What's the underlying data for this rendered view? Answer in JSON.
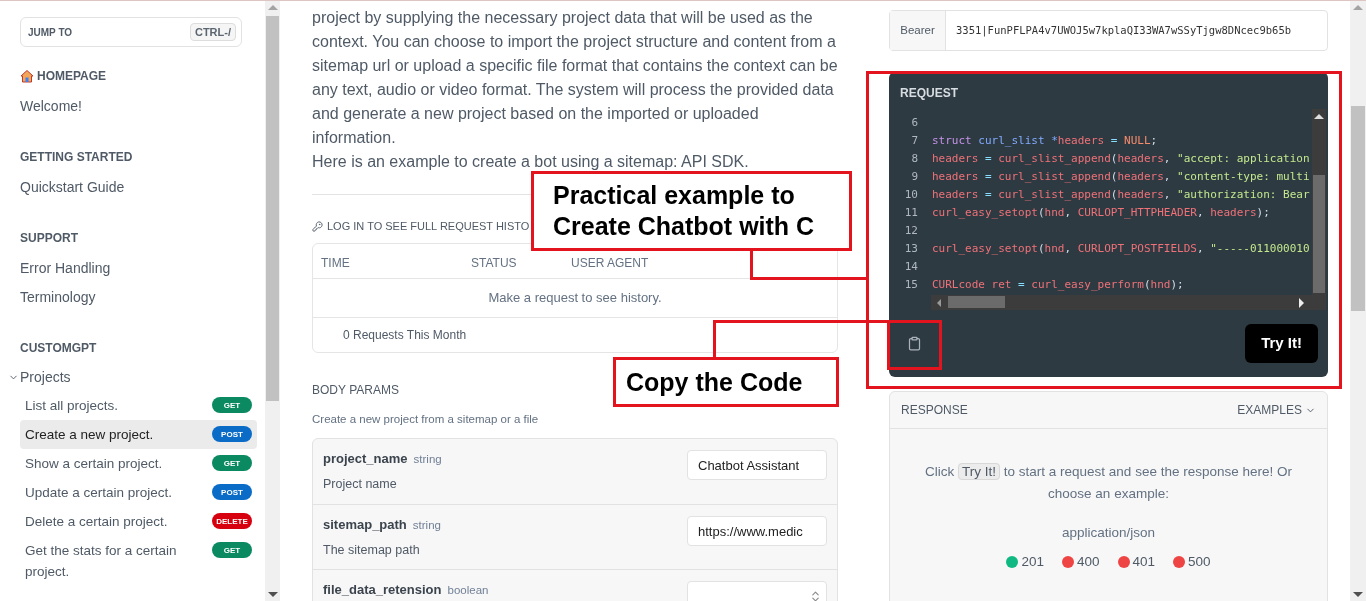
{
  "sidebar": {
    "jump_to": {
      "label": "JUMP TO",
      "shortcut": "CTRL-/"
    },
    "sections": [
      {
        "heading": "HOMEPAGE",
        "kind": "home",
        "items": [
          {
            "label": "Welcome!"
          }
        ]
      },
      {
        "heading": "GETTING STARTED",
        "items": [
          {
            "label": "Quickstart Guide"
          }
        ]
      },
      {
        "heading": "SUPPORT",
        "items": [
          {
            "label": "Error Handling"
          },
          {
            "label": "Terminology"
          }
        ]
      },
      {
        "heading": "CUSTOMGPT",
        "groups": [
          {
            "label": "Projects",
            "expanded": true,
            "children": [
              {
                "label": "List all projects.",
                "method": "GET",
                "color": "#0b8a62",
                "selected": false
              },
              {
                "label": "Create a new project.",
                "method": "POST",
                "color": "#0b6cc7",
                "selected": true
              },
              {
                "label": "Show a certain project.",
                "method": "GET",
                "color": "#0b8a62",
                "selected": false
              },
              {
                "label": "Update a certain project.",
                "method": "POST",
                "color": "#0b6cc7",
                "selected": false
              },
              {
                "label": "Delete a certain project.",
                "method": "DELETE",
                "color": "#d7000f",
                "selected": false
              },
              {
                "label": "Get the stats for a certain project.",
                "method": "GET",
                "color": "#0b8a62",
                "selected": false
              }
            ]
          }
        ]
      }
    ]
  },
  "intro": [
    "project by supplying the necessary project data that will be used as the context. You can choose to import the project structure and content from a sitemap url or upload a specific file format that contains the context can be any text, audio or video format. The system will process the provided data and generate a new project based on the imported or uploaded information.",
    "Here is an example to create a bot using a sitemap: API SDK."
  ],
  "history": {
    "heading": "LOG IN TO SEE FULL REQUEST HISTO",
    "columns": [
      "TIME",
      "STATUS",
      "USER AGENT"
    ],
    "empty": "Make a request to see history.",
    "footer": "0 Requests This Month"
  },
  "body_params": {
    "heading": "BODY PARAMS",
    "description": "Create a new project from a sitemap or a file",
    "params": [
      {
        "name": "project_name",
        "type": "string",
        "description": "Project name",
        "kind": "text",
        "value": "Chatbot Assistant"
      },
      {
        "name": "sitemap_path",
        "type": "string",
        "description": "The sitemap path",
        "kind": "text",
        "value": "https://www.medic"
      },
      {
        "name": "file_data_retension",
        "type": "boolean",
        "kind": "select"
      }
    ]
  },
  "auth": {
    "scheme": "Bearer",
    "token": "3351|FunPFLPA4v7UWOJ5w7kplaQI33WA7wSSyTjgw8DNcec9b65b"
  },
  "request": {
    "title": "REQUEST",
    "try_button": "Try It!",
    "code": [
      {
        "n": "6"
      },
      {
        "n": "7",
        "tokens": [
          {
            "t": "struct",
            "kind": "keyword"
          },
          {
            "t": " curl_slist",
            "kind": "type"
          },
          {
            "t": " *",
            "kind": "type"
          },
          {
            "t": "headers",
            "kind": "ident"
          },
          {
            "t": " = ",
            "kind": "op"
          },
          {
            "t": "NULL",
            "kind": "constant"
          },
          {
            "t": ";",
            "kind": "plain"
          }
        ]
      },
      {
        "n": "8",
        "tokens": [
          {
            "t": "headers",
            "kind": "ident"
          },
          {
            "t": " = ",
            "kind": "op"
          },
          {
            "t": "curl_slist_append",
            "kind": "ident"
          },
          {
            "t": "(",
            "kind": "plain"
          },
          {
            "t": "headers",
            "kind": "ident"
          },
          {
            "t": ", ",
            "kind": "plain"
          },
          {
            "t": "\"accept: application",
            "kind": "string"
          }
        ]
      },
      {
        "n": "9",
        "tokens": [
          {
            "t": "headers",
            "kind": "ident"
          },
          {
            "t": " = ",
            "kind": "op"
          },
          {
            "t": "curl_slist_append",
            "kind": "ident"
          },
          {
            "t": "(",
            "kind": "plain"
          },
          {
            "t": "headers",
            "kind": "ident"
          },
          {
            "t": ", ",
            "kind": "plain"
          },
          {
            "t": "\"content-type: multi",
            "kind": "string"
          }
        ]
      },
      {
        "n": "10",
        "tokens": [
          {
            "t": "headers",
            "kind": "ident"
          },
          {
            "t": " = ",
            "kind": "op"
          },
          {
            "t": "curl_slist_append",
            "kind": "ident"
          },
          {
            "t": "(",
            "kind": "plain"
          },
          {
            "t": "headers",
            "kind": "ident"
          },
          {
            "t": ", ",
            "kind": "plain"
          },
          {
            "t": "\"authorization: Bear",
            "kind": "string"
          }
        ]
      },
      {
        "n": "11",
        "tokens": [
          {
            "t": "curl_easy_setopt",
            "kind": "ident"
          },
          {
            "t": "(",
            "kind": "plain"
          },
          {
            "t": "hnd",
            "kind": "ident"
          },
          {
            "t": ", ",
            "kind": "plain"
          },
          {
            "t": "CURLOPT_HTTPHEADER",
            "kind": "ident"
          },
          {
            "t": ", ",
            "kind": "plain"
          },
          {
            "t": "headers",
            "kind": "ident"
          },
          {
            "t": ");",
            "kind": "plain"
          }
        ]
      },
      {
        "n": "12"
      },
      {
        "n": "13",
        "tokens": [
          {
            "t": "curl_easy_setopt",
            "kind": "ident"
          },
          {
            "t": "(",
            "kind": "plain"
          },
          {
            "t": "hnd",
            "kind": "ident"
          },
          {
            "t": ", ",
            "kind": "plain"
          },
          {
            "t": "CURLOPT_POSTFIELDS",
            "kind": "ident"
          },
          {
            "t": ", ",
            "kind": "plain"
          },
          {
            "t": "\"-----011000010",
            "kind": "string"
          }
        ]
      },
      {
        "n": "14"
      },
      {
        "n": "15",
        "tokens": [
          {
            "t": "CURLcode ret",
            "kind": "ident"
          },
          {
            "t": " = ",
            "kind": "op"
          },
          {
            "t": "curl_easy_perform",
            "kind": "ident"
          },
          {
            "t": "(",
            "kind": "plain"
          },
          {
            "t": "hnd",
            "kind": "ident"
          },
          {
            "t": ");",
            "kind": "plain"
          }
        ]
      }
    ]
  },
  "response": {
    "title": "RESPONSE",
    "examples": "EXAMPLES",
    "message_before": "Click",
    "message_chip": "Try It!",
    "message_after": "to start a request and see the response here! Or choose an example:",
    "media_type": "application/json",
    "statuses": [
      {
        "code": "201",
        "color": "#10b981"
      },
      {
        "code": "400",
        "color": "#ef4444"
      },
      {
        "code": "401",
        "color": "#ef4444"
      },
      {
        "code": "500",
        "color": "#ef4444"
      }
    ]
  },
  "annotations": [
    {
      "text": "Practical example to Create Chatbot with C"
    },
    {
      "text": "Copy the Code"
    }
  ]
}
